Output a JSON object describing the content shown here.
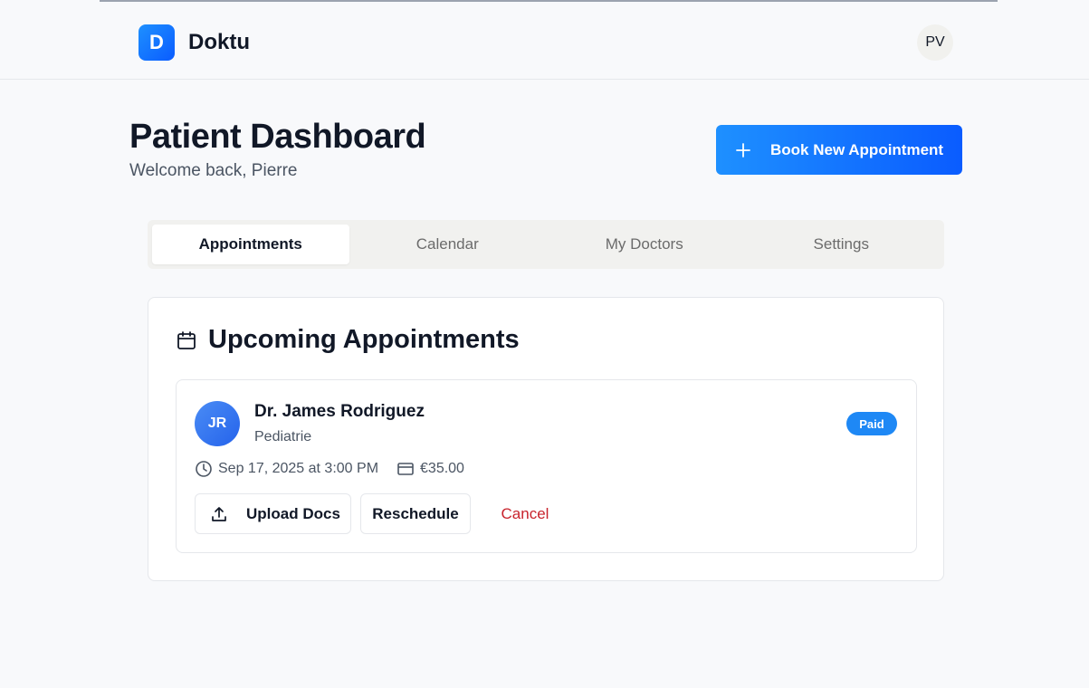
{
  "header": {
    "logo_letter": "D",
    "app_name": "Doktu",
    "user_initials": "PV"
  },
  "page": {
    "title": "Patient Dashboard",
    "subtitle": "Welcome back, Pierre",
    "book_button_label": "Book New Appointment"
  },
  "tabs": [
    {
      "label": "Appointments",
      "active": true
    },
    {
      "label": "Calendar",
      "active": false
    },
    {
      "label": "My Doctors",
      "active": false
    },
    {
      "label": "Settings",
      "active": false
    }
  ],
  "upcoming": {
    "title": "Upcoming Appointments",
    "icon": "calendar-icon",
    "appointments": [
      {
        "initials": "JR",
        "doctor": "Dr. James Rodriguez",
        "specialty": "Pediatrie",
        "status": "Paid",
        "datetime": "Sep 17, 2025 at 3:00 PM",
        "price": "€35.00",
        "actions": {
          "upload": "Upload Docs",
          "reschedule": "Reschedule",
          "cancel": "Cancel"
        }
      }
    ]
  },
  "colors": {
    "brand": "#0a5cff",
    "accent": "#1e90ff",
    "badge": "#1e88f5",
    "danger": "#c8232c"
  }
}
